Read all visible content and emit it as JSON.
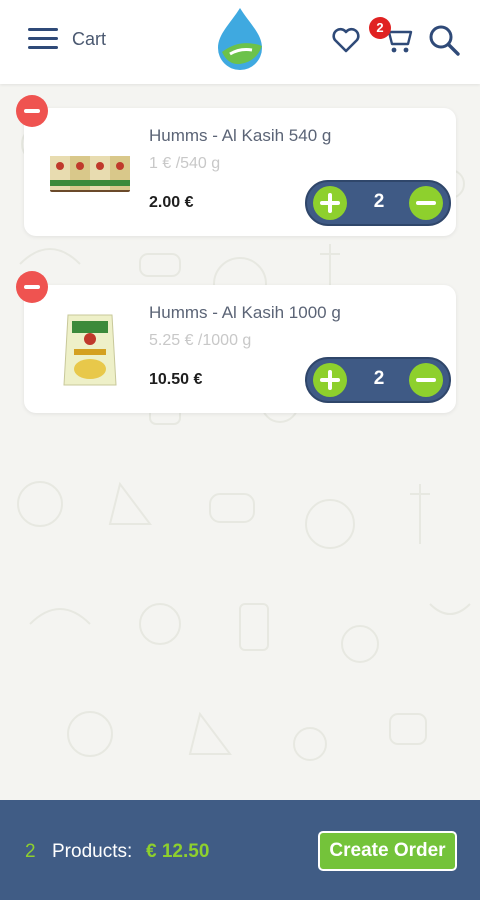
{
  "header": {
    "title": "Cart",
    "cart_badge": "2",
    "icons": [
      "menu-icon",
      "logo",
      "heart-icon",
      "cart-icon",
      "search-icon"
    ]
  },
  "cart": {
    "items": [
      {
        "name": "Humms - Al Kasih 540 g",
        "unit_price": "1 € /540 g",
        "total": "2.00 €",
        "quantity": "2"
      },
      {
        "name": "Humms - Al Kasih 1000 g",
        "unit_price": "5.25 € /1000 g",
        "total": "10.50 €",
        "quantity": "2"
      }
    ]
  },
  "footer": {
    "count": "2",
    "label": "Products:",
    "total": "€ 12.50",
    "order_button": "Create Order"
  },
  "colors": {
    "primary": "#405c85",
    "accent": "#8ed02d",
    "remove": "#ef5350",
    "badge": "#e02222"
  }
}
